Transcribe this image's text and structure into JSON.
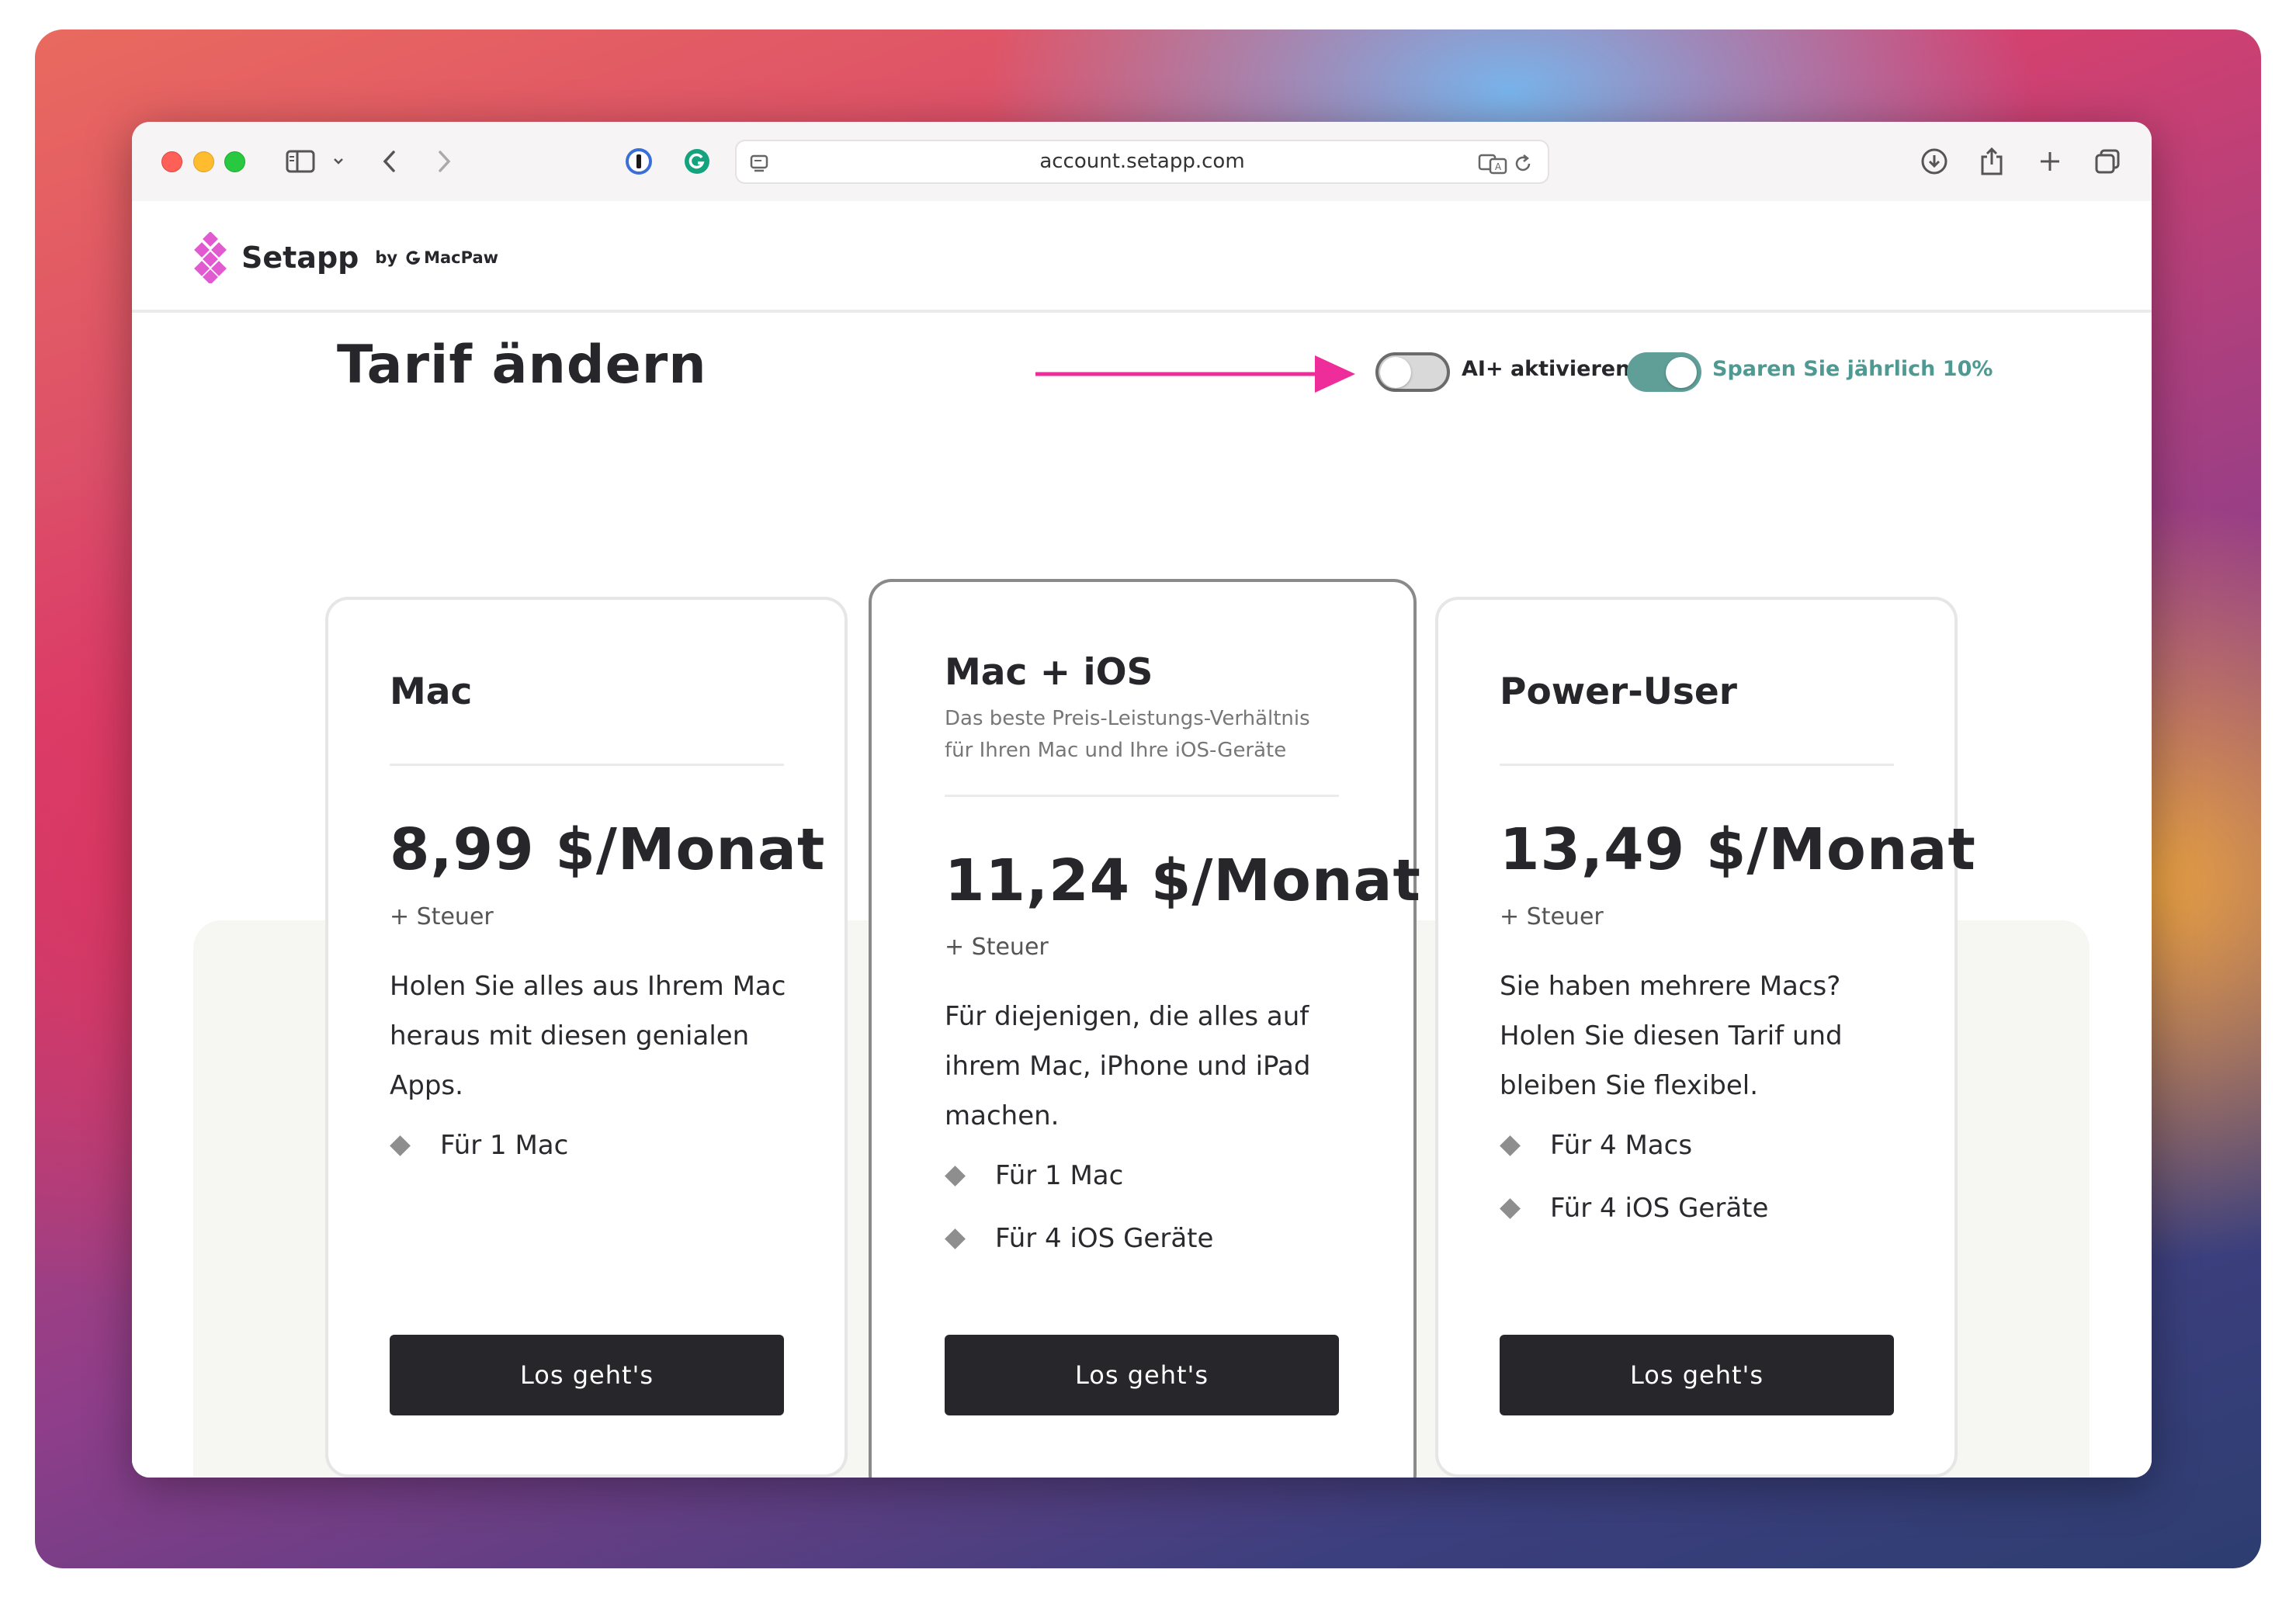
{
  "browser": {
    "url": "account.setapp.com"
  },
  "site": {
    "brand_name": "Setapp",
    "brand_by": "by",
    "brand_parent": "MacPaw",
    "logo_color": "#e25ad0"
  },
  "page": {
    "title": "Tarif ändern",
    "toggle_ai_label": "AI+ aktivieren",
    "toggle_ai_on": false,
    "toggle_save_label": "Sparen Sie jährlich 10%",
    "toggle_save_on": true,
    "accent_color": "#5f9f98",
    "arrow_color": "#ee2d9b"
  },
  "plans": [
    {
      "name": "Mac",
      "subtitle": "",
      "price": "8,99 $/Monat",
      "tax": "+ Steuer",
      "desc_lines": [
        "Holen Sie alles aus Ihrem Mac",
        "heraus mit diesen genialen",
        "Apps."
      ],
      "features": [
        "Für 1 Mac"
      ],
      "cta": "Los geht's"
    },
    {
      "name": "Mac + iOS",
      "subtitle_lines": [
        "Das beste Preis-Leistungs-Verhältnis",
        "für Ihren Mac und Ihre iOS-Geräte"
      ],
      "price": "11,24 $/Monat",
      "tax": "+ Steuer",
      "desc_lines": [
        "Für diejenigen, die alles auf",
        "ihrem Mac, iPhone und iPad",
        "machen."
      ],
      "features": [
        "Für 1 Mac",
        "Für 4 iOS Geräte"
      ],
      "cta": "Los geht's"
    },
    {
      "name": "Power-User",
      "subtitle": "",
      "price": "13,49 $/Monat",
      "tax": "+ Steuer",
      "desc_lines": [
        "Sie haben mehrere Macs?",
        "Holen Sie diesen Tarif und",
        "bleiben Sie flexibel."
      ],
      "features": [
        "Für 4 Macs",
        "Für 4 iOS Geräte"
      ],
      "cta": "Los geht's"
    }
  ]
}
